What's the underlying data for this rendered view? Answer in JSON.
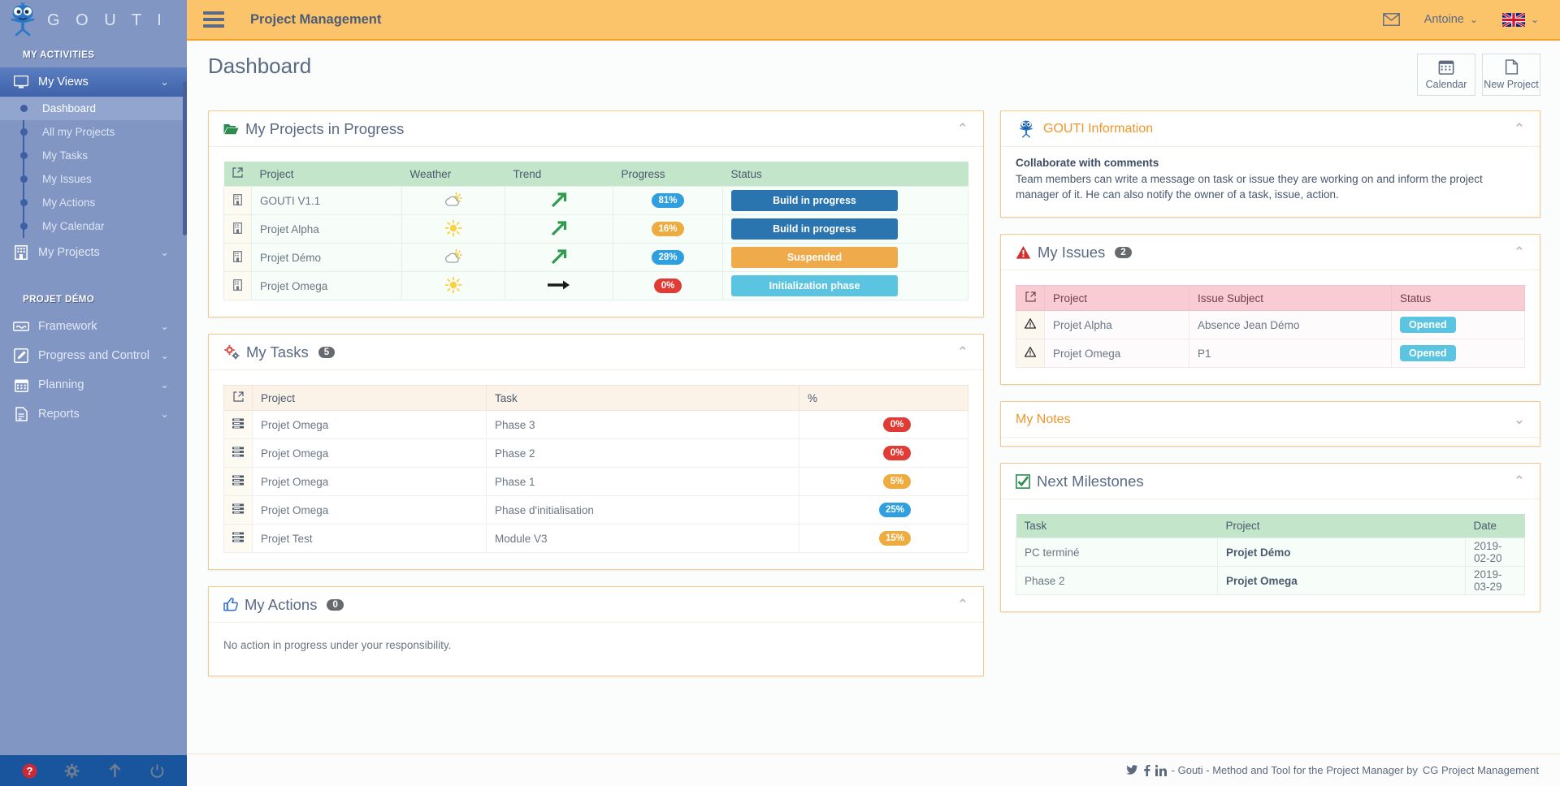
{
  "brand": {
    "name": "G O U T I",
    "logo_icon": "gouti-mascot-icon"
  },
  "sidebar": {
    "section_activities": "MY ACTIVITIES",
    "section_project": "PROJET DÉMO",
    "my_views": {
      "label": "My Views",
      "icon": "monitor-icon",
      "chevron": "chevron-down-icon"
    },
    "views_children": [
      {
        "label": "Dashboard",
        "active": true
      },
      {
        "label": "All my Projects",
        "active": false
      },
      {
        "label": "My Tasks",
        "active": false
      },
      {
        "label": "My Issues",
        "active": false
      },
      {
        "label": "My Actions",
        "active": false
      },
      {
        "label": "My Calendar",
        "active": false
      }
    ],
    "my_projects": {
      "label": "My Projects",
      "icon": "building-icon"
    },
    "project_menu": [
      {
        "label": "Framework",
        "icon": "handshake-icon"
      },
      {
        "label": "Progress and Control",
        "icon": "edit-note-icon"
      },
      {
        "label": "Planning",
        "icon": "calendar-icon"
      },
      {
        "label": "Reports",
        "icon": "document-icon"
      }
    ],
    "footer_icons": [
      {
        "name": "help-icon",
        "color": "#cc2936"
      },
      {
        "name": "gear-icon",
        "color": "#6f7d92"
      },
      {
        "name": "arrow-up-icon",
        "color": "#6f7d92"
      },
      {
        "name": "power-icon",
        "color": "#6f7d92"
      }
    ]
  },
  "topbar": {
    "menu_icon": "hamburger-icon",
    "title": "Project Management",
    "mail_icon": "envelope-icon",
    "user": "Antoine",
    "user_chevron": "chevron-down-icon",
    "lang_flag": "uk-flag-icon",
    "lang_chevron": "chevron-down-icon"
  },
  "page": {
    "title": "Dashboard",
    "buttons": [
      {
        "label": "Calendar",
        "icon": "calendar-icon"
      },
      {
        "label": "New Project",
        "icon": "page-icon"
      }
    ]
  },
  "projects_panel": {
    "title": "My Projects in Progress",
    "icon": "open-folder-icon",
    "collapse_icon": "chevron-up-icon",
    "columns": [
      "",
      "Project",
      "Weather",
      "Trend",
      "Progress",
      "Status"
    ],
    "link_header_icon": "external-link-icon",
    "rows": [
      {
        "icon": "project-icon",
        "project": "GOUTI V1.1",
        "weather": "partly-cloudy-icon",
        "trend": "arrow-up-right-icon",
        "progress": "81%",
        "progress_color": "blue",
        "status": "Build in progress",
        "status_color": "blue"
      },
      {
        "icon": "project-icon",
        "project": "Projet Alpha",
        "weather": "sun-icon",
        "trend": "arrow-up-right-icon",
        "progress": "16%",
        "progress_color": "orange",
        "status": "Build in progress",
        "status_color": "blue"
      },
      {
        "icon": "project-icon",
        "project": "Projet Démo",
        "weather": "partly-cloudy-icon",
        "trend": "arrow-up-right-icon",
        "progress": "28%",
        "progress_color": "blue",
        "status": "Suspended",
        "status_color": "orange"
      },
      {
        "icon": "project-icon",
        "project": "Projet Omega",
        "weather": "sun-icon",
        "trend": "arrow-right-icon",
        "progress": "0%",
        "progress_color": "red",
        "status": "Initialization phase",
        "status_color": "lightblue"
      }
    ]
  },
  "tasks_panel": {
    "title": "My Tasks",
    "count": "5",
    "icon": "gears-icon",
    "collapse_icon": "chevron-up-icon",
    "columns": [
      "",
      "Project",
      "Task",
      "%"
    ],
    "rows": [
      {
        "icon": "task-list-icon",
        "project": "Projet Omega",
        "task": "Phase 3",
        "pct": "0%",
        "pct_color": "red"
      },
      {
        "icon": "task-list-icon",
        "project": "Projet Omega",
        "task": "Phase 2",
        "pct": "0%",
        "pct_color": "red"
      },
      {
        "icon": "task-list-icon",
        "project": "Projet Omega",
        "task": "Phase 1",
        "pct": "5%",
        "pct_color": "orange"
      },
      {
        "icon": "task-list-icon",
        "project": "Projet Omega",
        "task": "Phase d'initialisation",
        "pct": "25%",
        "pct_color": "blue"
      },
      {
        "icon": "task-list-icon",
        "project": "Projet Test",
        "task": "Module V3",
        "pct": "15%",
        "pct_color": "orange"
      }
    ]
  },
  "actions_panel": {
    "title": "My Actions",
    "count": "0",
    "icon": "thumbs-up-icon",
    "collapse_icon": "chevron-up-icon",
    "empty_message": "No action in progress under your responsibility."
  },
  "info_panel": {
    "title": "GOUTI Information",
    "icon": "gouti-mascot-icon",
    "collapse_icon": "chevron-up-icon",
    "heading": "Collaborate with comments",
    "body": "Team members can write a message on task or issue they are working on and inform the project manager of it. He can also notify the owner of a task, issue, action."
  },
  "issues_panel": {
    "title": "My Issues",
    "count": "2",
    "icon": "warning-triangle-icon",
    "collapse_icon": "chevron-up-icon",
    "columns": [
      "",
      "Project",
      "Issue Subject",
      "Status"
    ],
    "rows": [
      {
        "icon": "warning-triangle-icon",
        "project": "Projet Alpha",
        "subject": "Absence Jean Démo",
        "status": "Opened"
      },
      {
        "icon": "warning-triangle-icon",
        "project": "Projet Omega",
        "subject": "P1",
        "status": "Opened"
      }
    ]
  },
  "notes_panel": {
    "title": "My Notes",
    "collapse_icon": "chevron-down-icon"
  },
  "milestones_panel": {
    "title": "Next Milestones",
    "icon": "checkbox-checked-icon",
    "collapse_icon": "chevron-up-icon",
    "columns": [
      "Task",
      "Project",
      "Date"
    ],
    "rows": [
      {
        "task": "PC terminé",
        "project": "Projet Démo",
        "date": "2019-02-20"
      },
      {
        "task": "Phase 2",
        "project": "Projet Omega",
        "date": "2019-03-29"
      }
    ]
  },
  "footer": {
    "twitter_icon": "twitter-icon",
    "facebook_icon": "facebook-icon",
    "linkedin_icon": "linkedin-icon",
    "text": "- Gouti - Method and Tool for the Project Manager by",
    "company": "CG Project Management"
  },
  "colors": {
    "sidebar_bg": "#8296c4",
    "topbar_bg": "#fbc46a",
    "accent_orange": "#f0952a",
    "status_blue": "#2a74b0",
    "status_orange": "#efab4b",
    "status_lightblue": "#5bc4e0",
    "pct_blue": "#2f9fe0",
    "pct_orange": "#eeab3f",
    "pct_red": "#e03b35",
    "table_green": "#c3e6cb",
    "table_pink": "#f9ccd3"
  }
}
